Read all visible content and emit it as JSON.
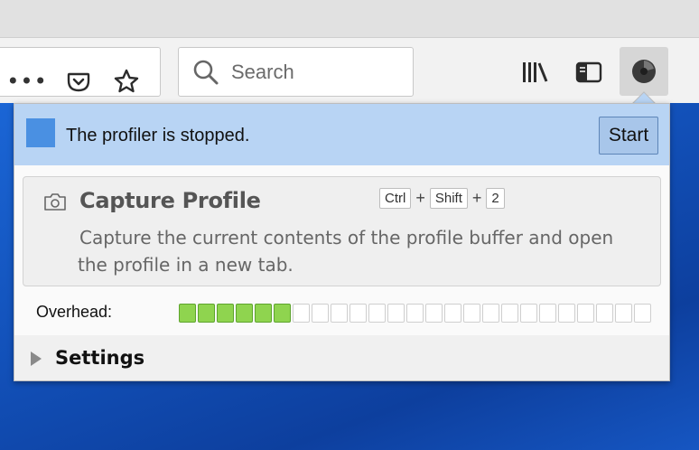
{
  "toolbar": {
    "more_icon": "ellipsis-icon",
    "pocket_icon": "pocket-icon",
    "bookmark_icon": "star-icon",
    "library_icon": "library-icon",
    "sidebar_icon": "sidebar-icon",
    "profiler_icon": "profiler-icon"
  },
  "search": {
    "placeholder": "Search"
  },
  "profiler_panel": {
    "status_text": "The profiler is stopped.",
    "start_label": "Start",
    "capture": {
      "title": "Capture Profile",
      "shortcut_keys": [
        "Ctrl",
        "Shift",
        "2"
      ],
      "shortcut_sep": "+",
      "description_line1": "Capture the current contents of the profile buffer and open",
      "description_line2": "the profile in a new tab."
    },
    "overhead": {
      "label": "Overhead:",
      "filled": 6,
      "total": 25
    },
    "settings_label": "Settings"
  },
  "colors": {
    "status_bg": "#b8d4f4",
    "status_square": "#4a90e2",
    "overhead_on": "#8fd44f"
  }
}
